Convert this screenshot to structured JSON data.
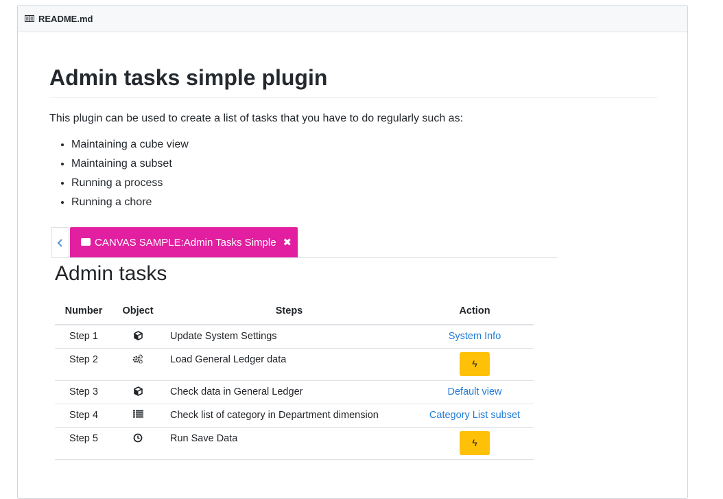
{
  "readme": {
    "filename": "README.md"
  },
  "doc": {
    "title": "Admin tasks simple plugin",
    "intro": "This plugin can be used to create a list of tasks that you have to do regularly such as:",
    "bullets": [
      "Maintaining a cube view",
      "Maintaining a subset",
      "Running a process",
      "Running a chore"
    ]
  },
  "screenshot": {
    "tab_label": "CANVAS SAMPLE:Admin Tasks Simple",
    "heading": "Admin tasks",
    "columns": [
      "Number",
      "Object",
      "Steps",
      "Action"
    ],
    "rows": [
      {
        "number": "Step 1",
        "icon": "cube-icon",
        "step": "Update System Settings",
        "action": "System Info"
      },
      {
        "number": "Step 2",
        "icon": "cogs-icon",
        "step": "Load General Ledger data",
        "action": ""
      },
      {
        "number": "Step 3",
        "icon": "cube-icon",
        "step": "Check data in General Ledger",
        "action": "Default view"
      },
      {
        "number": "Step 4",
        "icon": "list-icon",
        "step": "Check list of category in Department dimension",
        "action": "Category List subset"
      },
      {
        "number": "Step 5",
        "icon": "clock-icon",
        "step": "Run Save Data",
        "action": ""
      }
    ],
    "colors": {
      "tab_accent": "#e11fa0",
      "run_button": "#ffc107",
      "link": "#1f7ad8"
    }
  }
}
